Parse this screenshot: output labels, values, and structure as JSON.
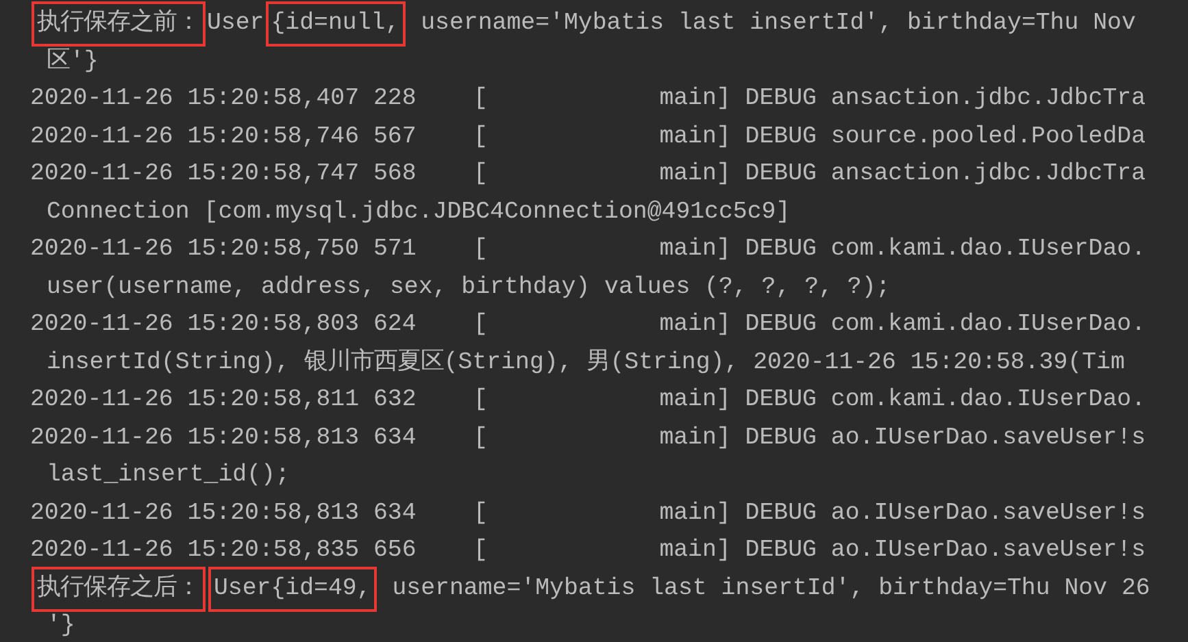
{
  "console": {
    "lines": [
      {
        "kind": "entry",
        "segments": [
          {
            "text": "执行保存之前：",
            "boxed": true
          },
          {
            "text": "User",
            "boxed": false
          },
          {
            "text": "{id=null,",
            "boxed": true
          },
          {
            "text": " username='Mybatis last insertId', birthday=Thu Nov",
            "boxed": false
          }
        ]
      },
      {
        "kind": "continuation",
        "segments": [
          {
            "text": "区'}",
            "boxed": false
          }
        ]
      },
      {
        "kind": "entry",
        "segments": [
          {
            "text": "2020-11-26 15:20:58,407 228    [            main] DEBUG ansaction.jdbc.JdbcTra",
            "boxed": false
          }
        ]
      },
      {
        "kind": "entry",
        "segments": [
          {
            "text": "2020-11-26 15:20:58,746 567    [            main] DEBUG source.pooled.PooledDa",
            "boxed": false
          }
        ]
      },
      {
        "kind": "entry",
        "segments": [
          {
            "text": "2020-11-26 15:20:58,747 568    [            main] DEBUG ansaction.jdbc.JdbcTra",
            "boxed": false
          }
        ]
      },
      {
        "kind": "continuation",
        "segments": [
          {
            "text": "Connection [com.mysql.jdbc.JDBC4Connection@491cc5c9]",
            "boxed": false
          }
        ]
      },
      {
        "kind": "entry",
        "segments": [
          {
            "text": "2020-11-26 15:20:58,750 571    [            main] DEBUG com.kami.dao.IUserDao.",
            "boxed": false
          }
        ]
      },
      {
        "kind": "continuation",
        "segments": [
          {
            "text": "user(username, address, sex, birthday) values (?, ?, ?, ?);",
            "boxed": false
          }
        ]
      },
      {
        "kind": "entry",
        "segments": [
          {
            "text": "2020-11-26 15:20:58,803 624    [            main] DEBUG com.kami.dao.IUserDao.",
            "boxed": false
          }
        ]
      },
      {
        "kind": "continuation",
        "segments": [
          {
            "text": "insertId(String), 银川市西夏区(String), 男(String), 2020-11-26 15:20:58.39(Tim",
            "boxed": false
          }
        ]
      },
      {
        "kind": "entry",
        "segments": [
          {
            "text": "2020-11-26 15:20:58,811 632    [            main] DEBUG com.kami.dao.IUserDao.",
            "boxed": false
          }
        ]
      },
      {
        "kind": "entry",
        "segments": [
          {
            "text": "2020-11-26 15:20:58,813 634    [            main] DEBUG ao.IUserDao.saveUser!s",
            "boxed": false
          }
        ]
      },
      {
        "kind": "continuation",
        "segments": [
          {
            "text": "last_insert_id();",
            "boxed": false
          }
        ]
      },
      {
        "kind": "entry",
        "segments": [
          {
            "text": "2020-11-26 15:20:58,813 634    [            main] DEBUG ao.IUserDao.saveUser!s",
            "boxed": false
          }
        ]
      },
      {
        "kind": "entry",
        "segments": [
          {
            "text": "2020-11-26 15:20:58,835 656    [            main] DEBUG ao.IUserDao.saveUser!s",
            "boxed": false
          }
        ]
      },
      {
        "kind": "entry",
        "segments": [
          {
            "text": "执行保存之后：",
            "boxed": true
          },
          {
            "text": "User{id=49,",
            "boxed": true
          },
          {
            "text": " username='Mybatis last insertId', birthday=Thu Nov 26",
            "boxed": false
          }
        ]
      },
      {
        "kind": "continuation",
        "segments": [
          {
            "text": "'}",
            "boxed": false
          }
        ]
      }
    ]
  }
}
